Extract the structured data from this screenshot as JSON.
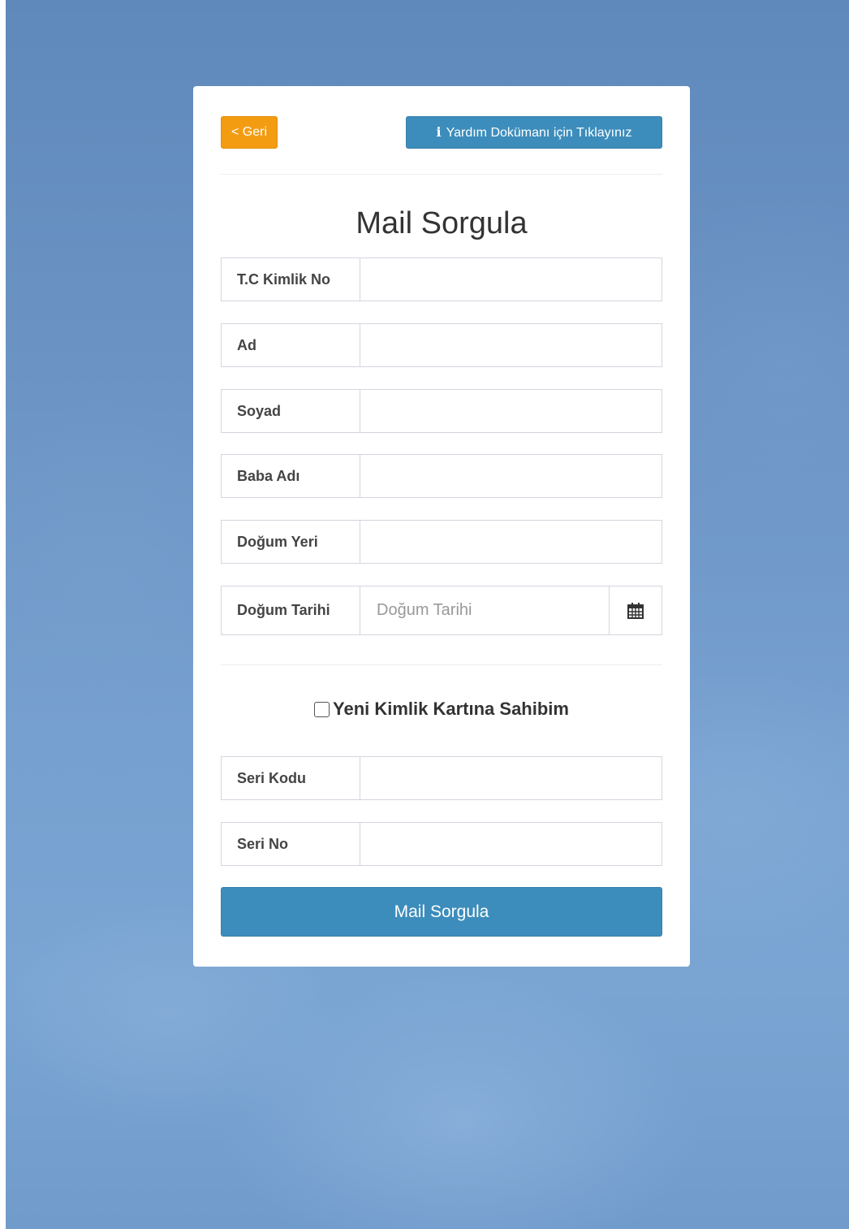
{
  "header": {
    "back_label": "< Geri",
    "help_label": "Yardım Dokümanı için Tıklayınız",
    "help_icon": "info-icon"
  },
  "form": {
    "title": "Mail Sorgula",
    "fields": {
      "tc": {
        "label": "T.C Kimlik No",
        "value": ""
      },
      "ad": {
        "label": "Ad",
        "value": ""
      },
      "soyad": {
        "label": "Soyad",
        "value": ""
      },
      "baba_adi": {
        "label": "Baba Adı",
        "value": ""
      },
      "dogum_yeri": {
        "label": "Doğum Yeri",
        "value": ""
      },
      "dogum_tarihi": {
        "label": "Doğum Tarihi",
        "value": "",
        "placeholder": "Doğum Tarihi",
        "icon": "calendar-icon"
      },
      "seri_kodu": {
        "label": "Seri Kodu",
        "value": ""
      },
      "seri_no": {
        "label": "Seri No",
        "value": ""
      }
    },
    "new_id_checkbox": {
      "label": "Yeni Kimlik Kartına Sahibim",
      "checked": false
    },
    "submit_label": "Mail Sorgula"
  },
  "colors": {
    "back_button": "#f39c12",
    "primary": "#3c8dbc",
    "background": "#6b94c4"
  }
}
